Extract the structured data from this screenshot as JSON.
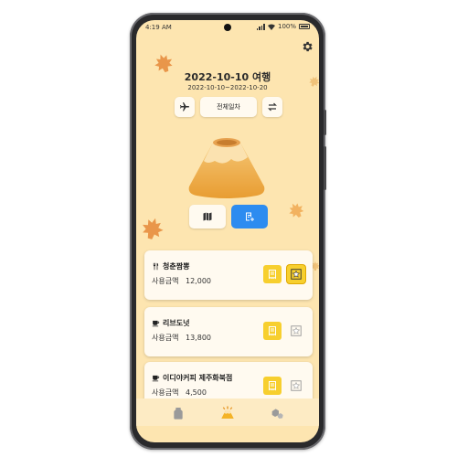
{
  "status_bar": {
    "time": "4:19 AM",
    "battery": "100%"
  },
  "trip": {
    "title": "2022-10-10 여행",
    "date_range": "2022-10-10~2022-10-20"
  },
  "controls": {
    "day_selector_label": "전체일차"
  },
  "expenses": [
    {
      "icon": "fork-knife-icon",
      "name": "청춘짬뽕",
      "amount_label": "사용금액",
      "amount": "12,000",
      "photo_starred": true
    },
    {
      "icon": "coffee-cup-icon",
      "name": "리브도넛",
      "amount_label": "사용금액",
      "amount": "13,800",
      "photo_starred": false
    },
    {
      "icon": "coffee-cup-icon",
      "name": "이디야커피 제주화북점",
      "amount_label": "사용금액",
      "amount": "4,500",
      "photo_starred": false
    }
  ],
  "colors": {
    "background": "#fde5b0",
    "accent_blue": "#2d8cf0",
    "yellow": "#f7cf2e",
    "leaf": "#e9964a"
  }
}
